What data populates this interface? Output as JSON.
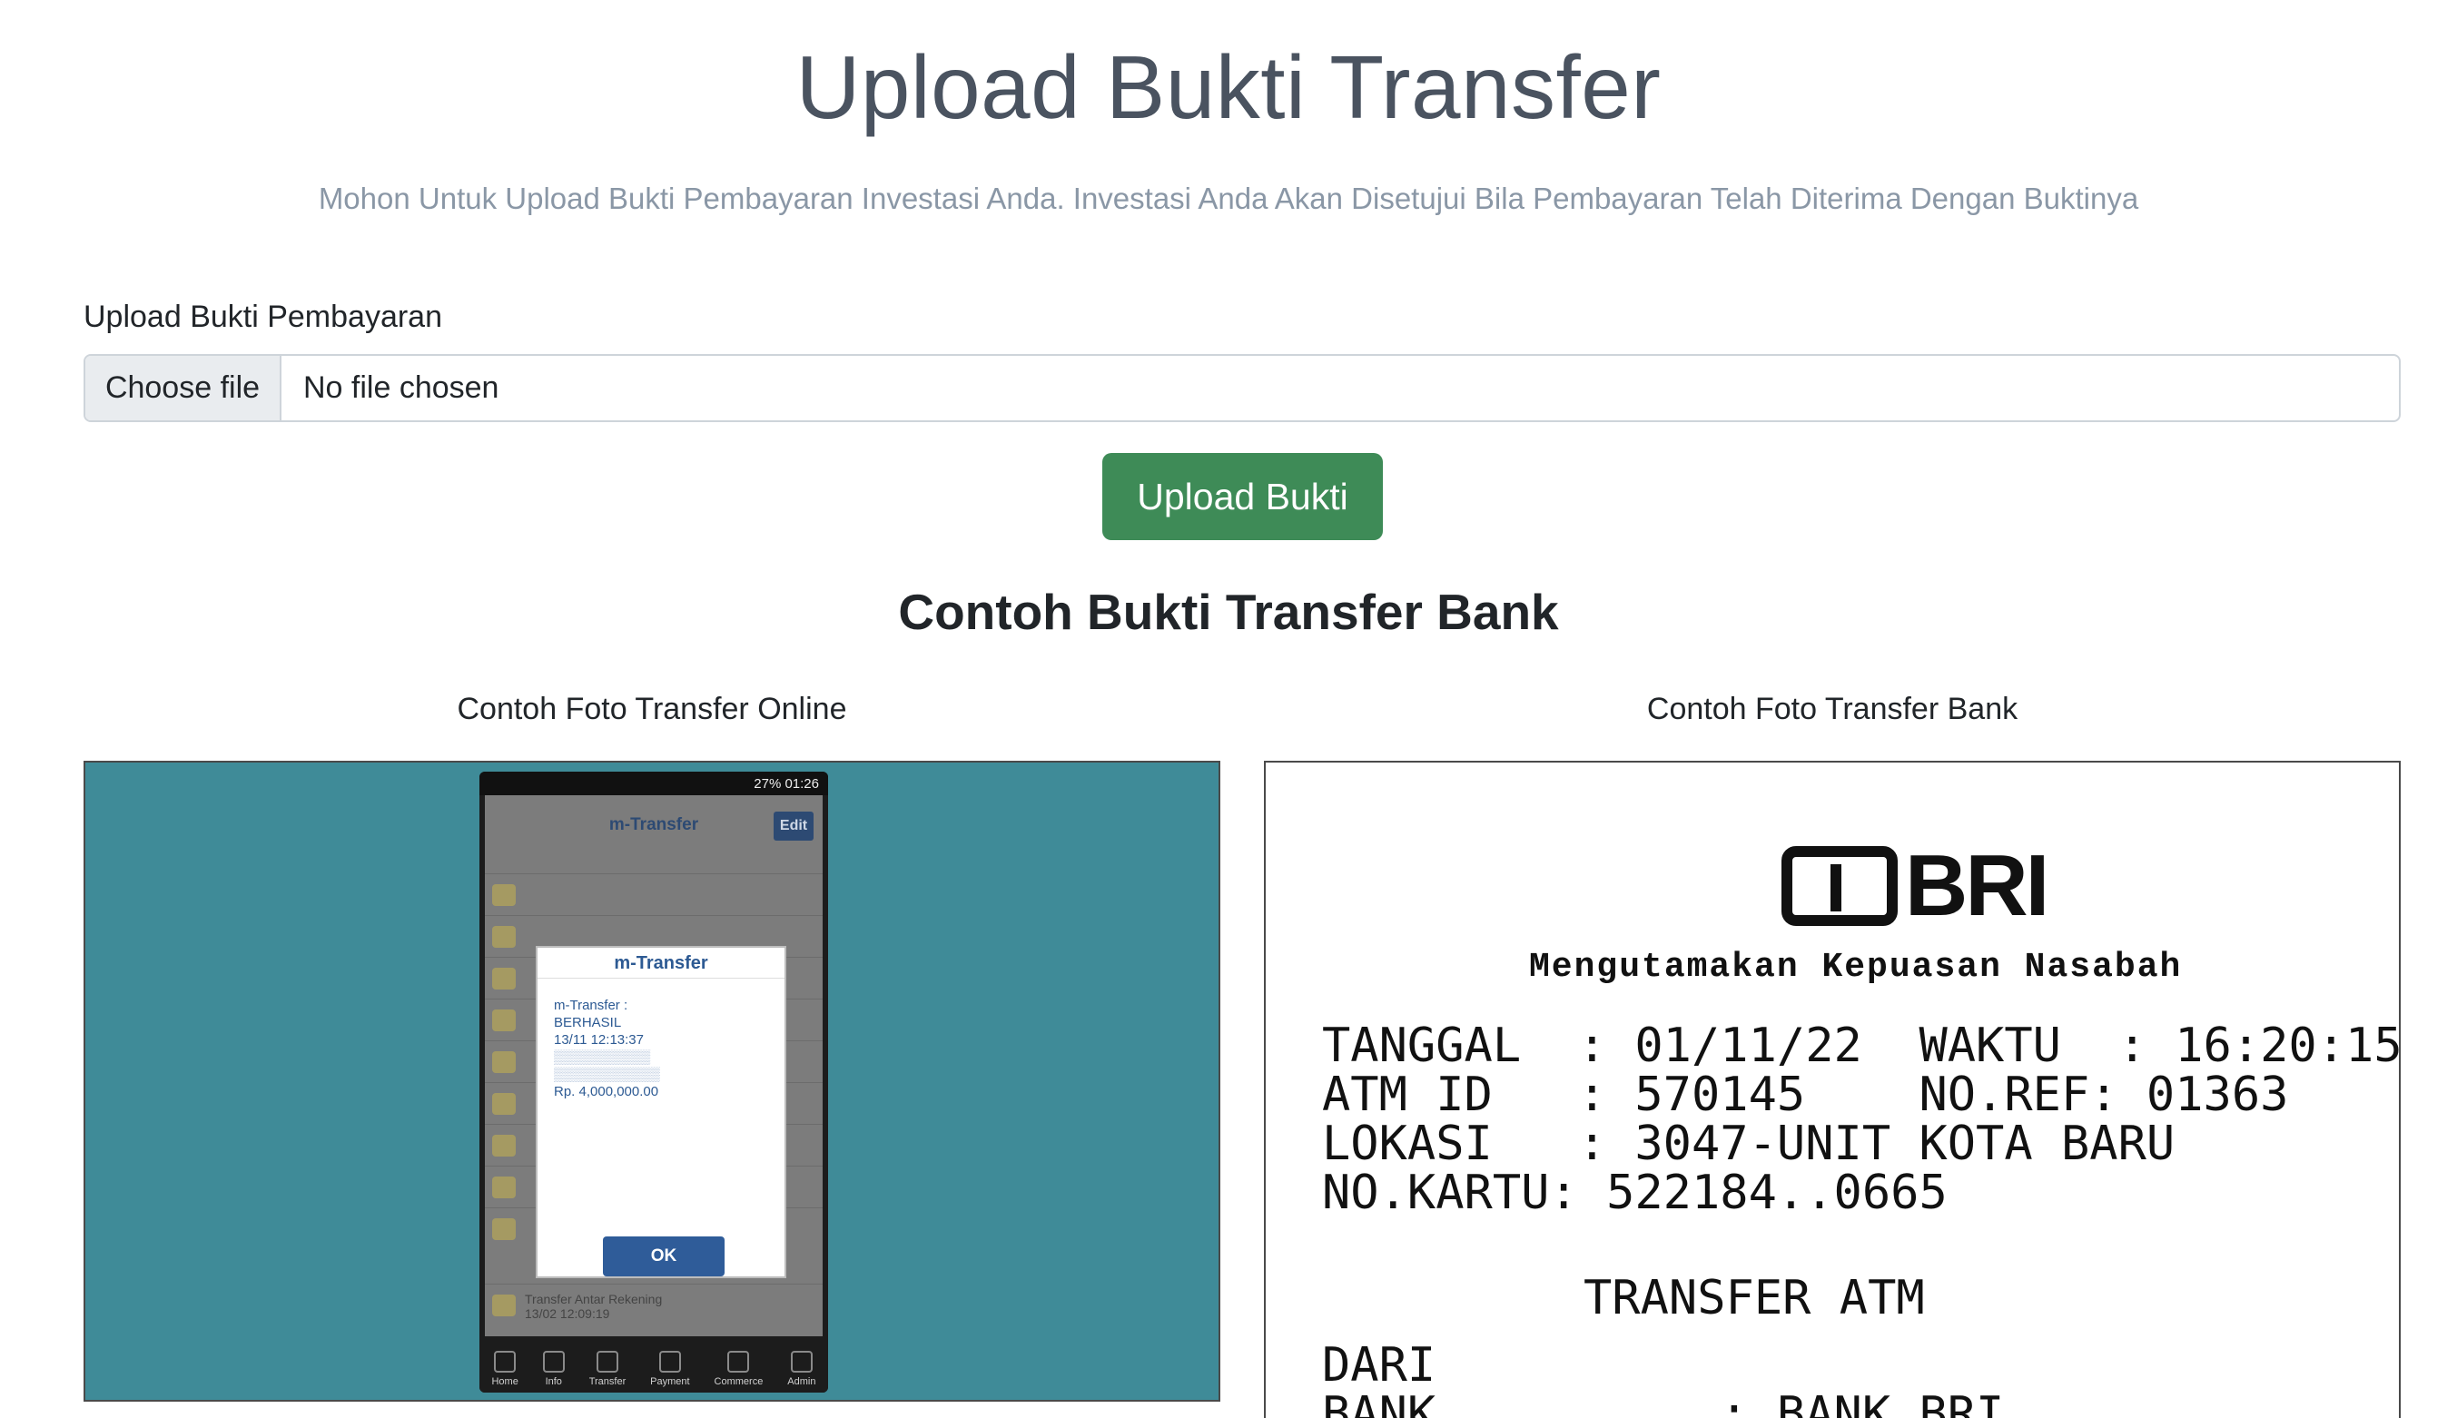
{
  "header": {
    "title": "Upload Bukti Transfer",
    "subtitle": "Mohon Untuk Upload Bukti Pembayaran Investasi Anda. Investasi Anda Akan Disetujui Bila Pembayaran Telah Diterima Dengan Buktinya"
  },
  "form": {
    "label": "Upload Bukti Pembayaran",
    "choose_file_label": "Choose file",
    "file_status": "No file chosen",
    "submit_label": "Upload Bukti"
  },
  "examples": {
    "section_title": "Contoh Bukti Transfer Bank",
    "online_caption": "Contoh Foto Transfer Online",
    "bank_caption": "Contoh Foto Transfer Bank"
  },
  "colors": {
    "button_green": "#3e8b57",
    "photo_background": "#3f8b98"
  },
  "phone_screenshot": {
    "status_bar": "27% 01:26",
    "app_title": "m-Transfer",
    "edit_label": "Edit",
    "dialog_title": "m-Transfer",
    "dialog_lines": [
      "m-Transfer :",
      "BERHASIL",
      "13/11 12:13:37",
      "Rp. 4,000,000.00"
    ],
    "ok_label": "OK",
    "last_row_label": "Transfer Antar Rekening",
    "last_row_date": "13/02 12:09:19",
    "nav": [
      "Home",
      "Info",
      "Transfer",
      "Payment",
      "Commerce",
      "Admin"
    ]
  },
  "receipt": {
    "brand": "BRI",
    "motto": "Mengutamakan Kepuasan Nasabah",
    "tanggal": "TANGGAL  : 01/11/22  WAKTU  : 16:20:15",
    "atm_id": "ATM ID   : 570145    NO.REF: 01363",
    "lokasi": "LOKASI   : 3047-UNIT KOTA BARU",
    "no_kartu": "NO.KARTU: 522184..0665",
    "transfer_type": "TRANSFER ATM",
    "dari": "DARI",
    "bank": "BANK          : BANK BRI"
  }
}
